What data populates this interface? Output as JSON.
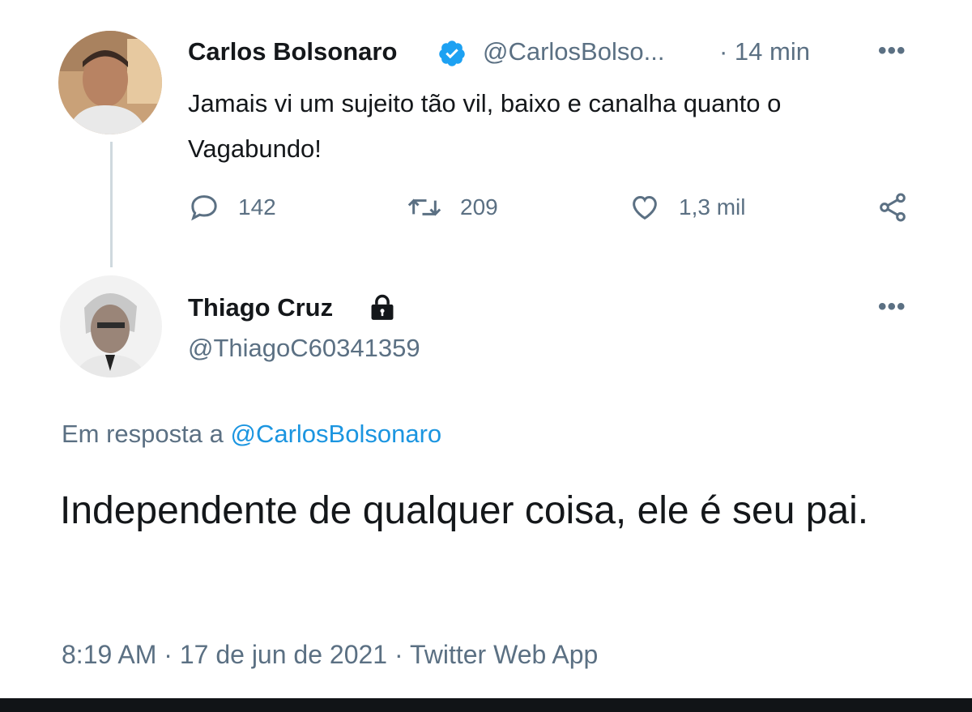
{
  "tweet": {
    "author_name": "Carlos Bolsonaro",
    "author_handle": "@CarlosBolso...",
    "time_ago": "· 14 min",
    "more": "•••",
    "text": "Jamais vi um sujeito tão vil, baixo e canalha quanto o Vagabundo!",
    "replies": "142",
    "retweets": "209",
    "likes": "1,3 mil",
    "verified": true
  },
  "reply": {
    "author_name": "Thiago Cruz",
    "author_handle": "@ThiagoC60341359",
    "more": "•••",
    "in_reply_to_prefix": "Em resposta a",
    "in_reply_to_handle": "@CarlosBolsonaro",
    "text": "Independente de qualquer coisa, ele é seu pai.",
    "timestamp": "8:19 AM · 17 de jun de 2021 · Twitter Web App",
    "protected": true
  },
  "colors": {
    "accent": "#1da1f2",
    "muted": "#5b7083",
    "text": "#14171a",
    "thread_line": "#cfd9de"
  }
}
